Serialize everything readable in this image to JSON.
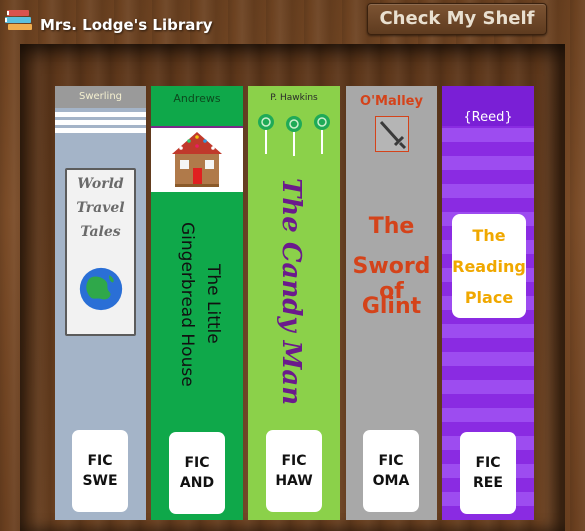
{
  "app": {
    "title": "Mrs. Lodge's Library",
    "check_button": "Check My Shelf"
  },
  "books": [
    {
      "author": "Swerling",
      "title_lines": [
        "World",
        "Travel",
        "Tales"
      ],
      "call_top": "FIC",
      "call_bottom": "SWE",
      "color": "#a4b4c8"
    },
    {
      "author": "Andrews",
      "title_lines": [
        "The Little",
        "Gingerbread House"
      ],
      "call_top": "FIC",
      "call_bottom": "AND",
      "color": "#0fa84a"
    },
    {
      "author": "P. Hawkins",
      "title": "The Candy Man",
      "call_top": "FIC",
      "call_bottom": "HAW",
      "color": "#8bd14a"
    },
    {
      "author": "O'Malley",
      "title_lines": [
        "The",
        "Sword of",
        "Glint"
      ],
      "call_top": "FIC",
      "call_bottom": "OMA",
      "color": "#a8a8a8"
    },
    {
      "author": "{Reed}",
      "title_lines": [
        "The",
        "Reading",
        "Place"
      ],
      "call_top": "FIC",
      "call_bottom": "REE",
      "color": "#8a2be2"
    }
  ]
}
